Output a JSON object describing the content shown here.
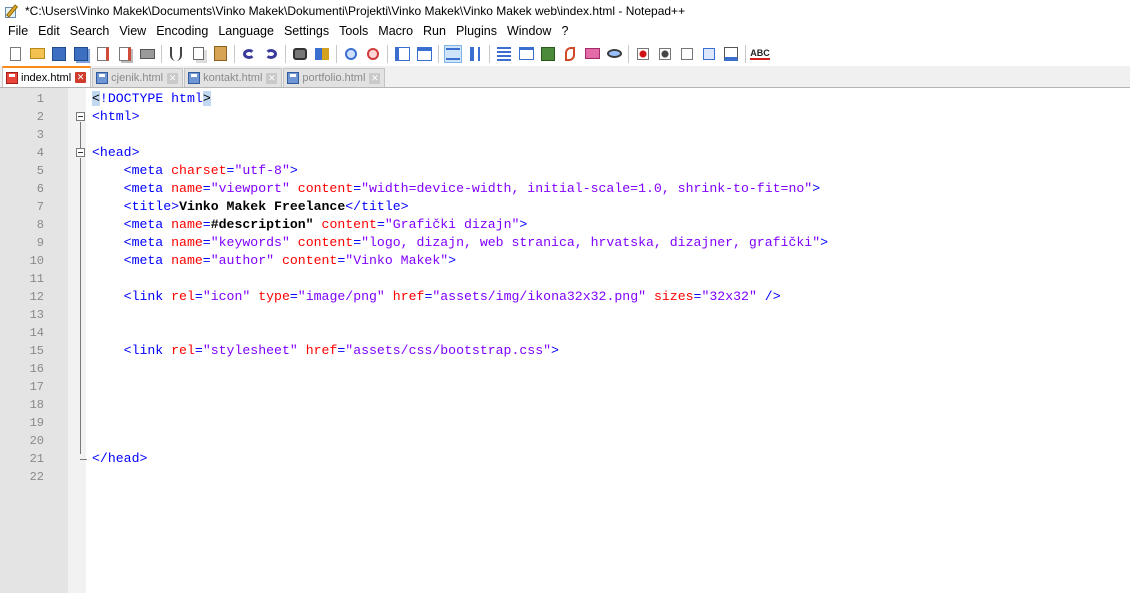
{
  "window": {
    "title": "*C:\\Users\\Vinko Makek\\Documents\\Vinko Makek\\Dokumenti\\Projekti\\Vinko Makek\\Vinko Makek web\\index.html - Notepad++"
  },
  "menu": [
    "File",
    "Edit",
    "Search",
    "View",
    "Encoding",
    "Language",
    "Settings",
    "Tools",
    "Macro",
    "Run",
    "Plugins",
    "Window",
    "?"
  ],
  "toolbar": {
    "buttons": [
      "new-file",
      "open-file",
      "save",
      "save-all",
      "close",
      "close-all",
      "print",
      "cut",
      "copy",
      "paste",
      "undo",
      "redo",
      "find",
      "replace",
      "zoom-in",
      "zoom-out",
      "sync-vertical",
      "sync-horizontal",
      "word-wrap",
      "show-all-chars",
      "indent-guide",
      "user-defined-language",
      "document-map",
      "function-list",
      "folder-as-workspace",
      "monitoring",
      "record-macro",
      "stop-record",
      "play-macro",
      "run-macro-multiple",
      "save-macro",
      "spell-check"
    ],
    "spell_label": "ABC"
  },
  "tabs": [
    {
      "label": "index.html",
      "active": true,
      "modified": true
    },
    {
      "label": "cjenik.html",
      "active": false,
      "modified": false
    },
    {
      "label": "kontakt.html",
      "active": false,
      "modified": false
    },
    {
      "label": "portfolio.html",
      "active": false,
      "modified": false
    }
  ],
  "colors": {
    "tag": "#0000ff",
    "attribute": "#ff0000",
    "value": "#8000ff",
    "active_tab_accent": "#fa8a1a"
  },
  "editor": {
    "lines": [
      {
        "n": "1",
        "code": [
          {
            "t": "hl",
            "v": "<"
          },
          {
            "t": "tag",
            "v": "!DOCTYPE html"
          },
          {
            "t": "hl",
            "v": ">"
          }
        ]
      },
      {
        "n": "2",
        "code": [
          {
            "t": "tag",
            "v": "<html>"
          }
        ]
      },
      {
        "n": "3",
        "code": []
      },
      {
        "n": "4",
        "code": [
          {
            "t": "tag",
            "v": "<head>"
          }
        ]
      },
      {
        "n": "5",
        "code": [
          {
            "t": "tag",
            "v": "    <meta "
          },
          {
            "t": "attr",
            "v": "charset"
          },
          {
            "t": "tag",
            "v": "="
          },
          {
            "t": "val",
            "v": "\"utf-8\""
          },
          {
            "t": "tag",
            "v": ">"
          }
        ]
      },
      {
        "n": "6",
        "code": [
          {
            "t": "tag",
            "v": "    <meta "
          },
          {
            "t": "attr",
            "v": "name"
          },
          {
            "t": "tag",
            "v": "="
          },
          {
            "t": "val",
            "v": "\"viewport\""
          },
          {
            "t": "tag",
            "v": " "
          },
          {
            "t": "attr",
            "v": "content"
          },
          {
            "t": "tag",
            "v": "="
          },
          {
            "t": "val",
            "v": "\"width=device-width, initial-scale=1.0, shrink-to-fit=no\""
          },
          {
            "t": "tag",
            "v": ">"
          }
        ]
      },
      {
        "n": "7",
        "code": [
          {
            "t": "tag",
            "v": "    <title>"
          },
          {
            "t": "txt",
            "v": "Vinko Makek Freelance"
          },
          {
            "t": "tag",
            "v": "</title>"
          }
        ]
      },
      {
        "n": "8",
        "code": [
          {
            "t": "tag",
            "v": "    <meta "
          },
          {
            "t": "attr",
            "v": "name"
          },
          {
            "t": "tag",
            "v": "="
          },
          {
            "t": "txt",
            "v": "#description\""
          },
          {
            "t": "tag",
            "v": " "
          },
          {
            "t": "attr",
            "v": "content"
          },
          {
            "t": "tag",
            "v": "="
          },
          {
            "t": "val",
            "v": "\"Grafički dizajn\""
          },
          {
            "t": "tag",
            "v": ">"
          }
        ]
      },
      {
        "n": "9",
        "code": [
          {
            "t": "tag",
            "v": "    <meta "
          },
          {
            "t": "attr",
            "v": "name"
          },
          {
            "t": "tag",
            "v": "="
          },
          {
            "t": "val",
            "v": "\"keywords\""
          },
          {
            "t": "tag",
            "v": " "
          },
          {
            "t": "attr",
            "v": "content"
          },
          {
            "t": "tag",
            "v": "="
          },
          {
            "t": "val",
            "v": "\"logo, dizajn, web stranica, hrvatska, dizajner, grafički\""
          },
          {
            "t": "tag",
            "v": ">"
          }
        ]
      },
      {
        "n": "10",
        "code": [
          {
            "t": "tag",
            "v": "    <meta "
          },
          {
            "t": "attr",
            "v": "name"
          },
          {
            "t": "tag",
            "v": "="
          },
          {
            "t": "val",
            "v": "\"author\""
          },
          {
            "t": "tag",
            "v": " "
          },
          {
            "t": "attr",
            "v": "content"
          },
          {
            "t": "tag",
            "v": "="
          },
          {
            "t": "val",
            "v": "\"Vinko Makek\""
          },
          {
            "t": "tag",
            "v": ">"
          }
        ]
      },
      {
        "n": "11",
        "code": []
      },
      {
        "n": "12",
        "code": [
          {
            "t": "tag",
            "v": "    <link "
          },
          {
            "t": "attr",
            "v": "rel"
          },
          {
            "t": "tag",
            "v": "="
          },
          {
            "t": "val",
            "v": "\"icon\""
          },
          {
            "t": "tag",
            "v": " "
          },
          {
            "t": "attr",
            "v": "type"
          },
          {
            "t": "tag",
            "v": "="
          },
          {
            "t": "val",
            "v": "\"image/png\""
          },
          {
            "t": "tag",
            "v": " "
          },
          {
            "t": "attr",
            "v": "href"
          },
          {
            "t": "tag",
            "v": "="
          },
          {
            "t": "val",
            "v": "\"assets/img/ikona32x32.png\""
          },
          {
            "t": "tag",
            "v": " "
          },
          {
            "t": "attr",
            "v": "sizes"
          },
          {
            "t": "tag",
            "v": "="
          },
          {
            "t": "val",
            "v": "\"32x32\""
          },
          {
            "t": "tag",
            "v": " />"
          }
        ]
      },
      {
        "n": "13",
        "code": []
      },
      {
        "n": "14",
        "code": []
      },
      {
        "n": "15",
        "code": [
          {
            "t": "tag",
            "v": "    <link "
          },
          {
            "t": "attr",
            "v": "rel"
          },
          {
            "t": "tag",
            "v": "="
          },
          {
            "t": "val",
            "v": "\"stylesheet\""
          },
          {
            "t": "tag",
            "v": " "
          },
          {
            "t": "attr",
            "v": "href"
          },
          {
            "t": "tag",
            "v": "="
          },
          {
            "t": "val",
            "v": "\"assets/css/bootstrap.css\""
          },
          {
            "t": "tag",
            "v": ">"
          }
        ]
      },
      {
        "n": "16",
        "code": []
      },
      {
        "n": "17",
        "code": []
      },
      {
        "n": "18",
        "code": []
      },
      {
        "n": "19",
        "code": []
      },
      {
        "n": "20",
        "code": []
      },
      {
        "n": "21",
        "code": [
          {
            "t": "tag",
            "v": "</head>"
          }
        ]
      },
      {
        "n": "22",
        "code": []
      }
    ]
  }
}
